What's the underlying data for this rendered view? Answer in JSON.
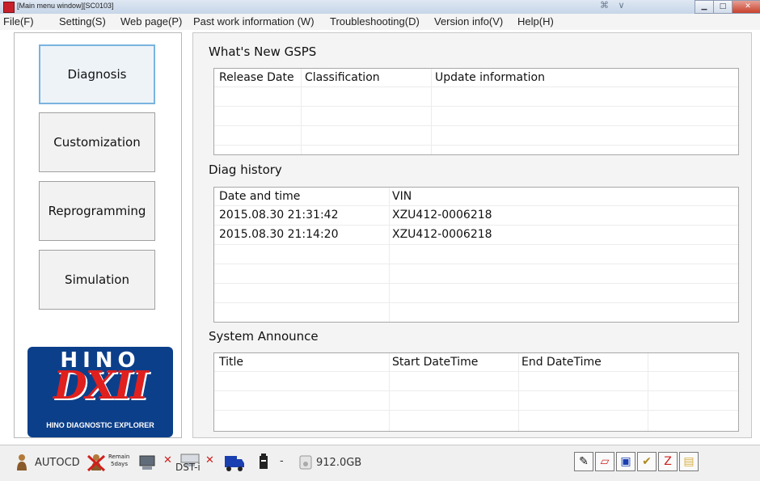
{
  "window": {
    "title": "[Main menu window][SC0103]",
    "mini_buttons": "⌘ ∨"
  },
  "menu": [
    "File(F)",
    "Setting(S)",
    "Web page(P)",
    "Past work information (W)",
    "Troubleshooting(D)",
    "Version info(V)",
    "Help(H)"
  ],
  "nav": {
    "diagnosis": "Diagnosis",
    "customization": "Customization",
    "reprogramming": "Reprogramming",
    "simulation": "Simulation"
  },
  "logo": {
    "brand": "HINO",
    "product": "DXII",
    "tagline": "HINO DIAGNOSTIC EXPLORER"
  },
  "whats_new": {
    "label": "What's New GSPS",
    "columns": [
      "Release Date",
      "Classification",
      "Update information"
    ],
    "rows": []
  },
  "diag_history": {
    "label": "Diag history",
    "columns": [
      "Date and time",
      "VIN"
    ],
    "rows": [
      [
        "2015.08.30 21:31:42",
        "XZU412-0006218"
      ],
      [
        "2015.08.30 21:14:20",
        "XZU412-0006218"
      ]
    ]
  },
  "system_announce": {
    "label": "System Announce",
    "columns": [
      "Title",
      "Start DateTime",
      "End DateTime"
    ],
    "rows": []
  },
  "statusbar": {
    "autocd": "AUTOCD",
    "remain_line1": "Remain",
    "remain_line2": "5days",
    "dst_label": "DST-i",
    "dash": "-",
    "disk": "912.0GB",
    "accent_color": "#0c3f8a",
    "error_color": "#d0201e"
  }
}
